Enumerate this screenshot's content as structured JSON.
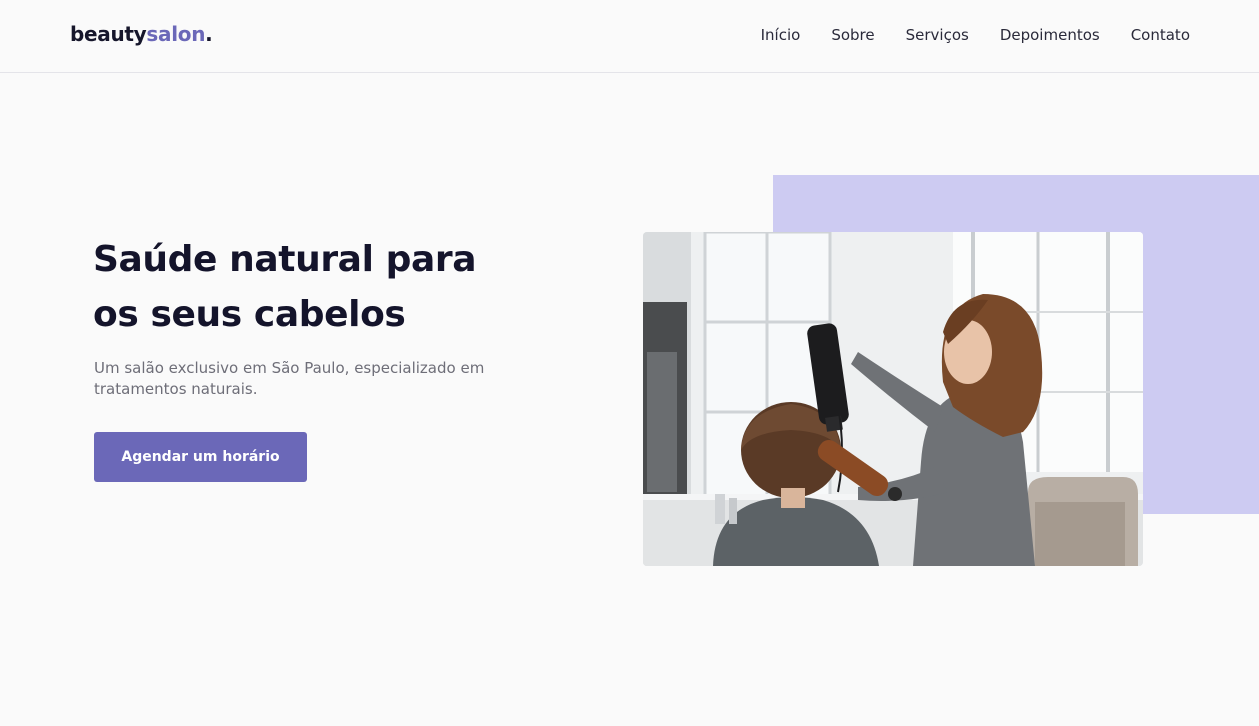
{
  "brand": {
    "name_part1": "beauty",
    "name_part2": "salon",
    "name_dot": ".",
    "accent_color": "#6b68b8"
  },
  "nav": {
    "items": [
      {
        "label": "Início"
      },
      {
        "label": "Sobre"
      },
      {
        "label": "Serviços"
      },
      {
        "label": "Depoimentos"
      },
      {
        "label": "Contato"
      }
    ]
  },
  "hero": {
    "title": "Saúde natural para os seus cabelos",
    "subtitle": "Um salão exclusivo em São Paulo, especializado em tratamentos naturais.",
    "cta_label": "Agendar um horário"
  },
  "image": {
    "alt": "",
    "backdrop_color": "#cdcbf2"
  }
}
